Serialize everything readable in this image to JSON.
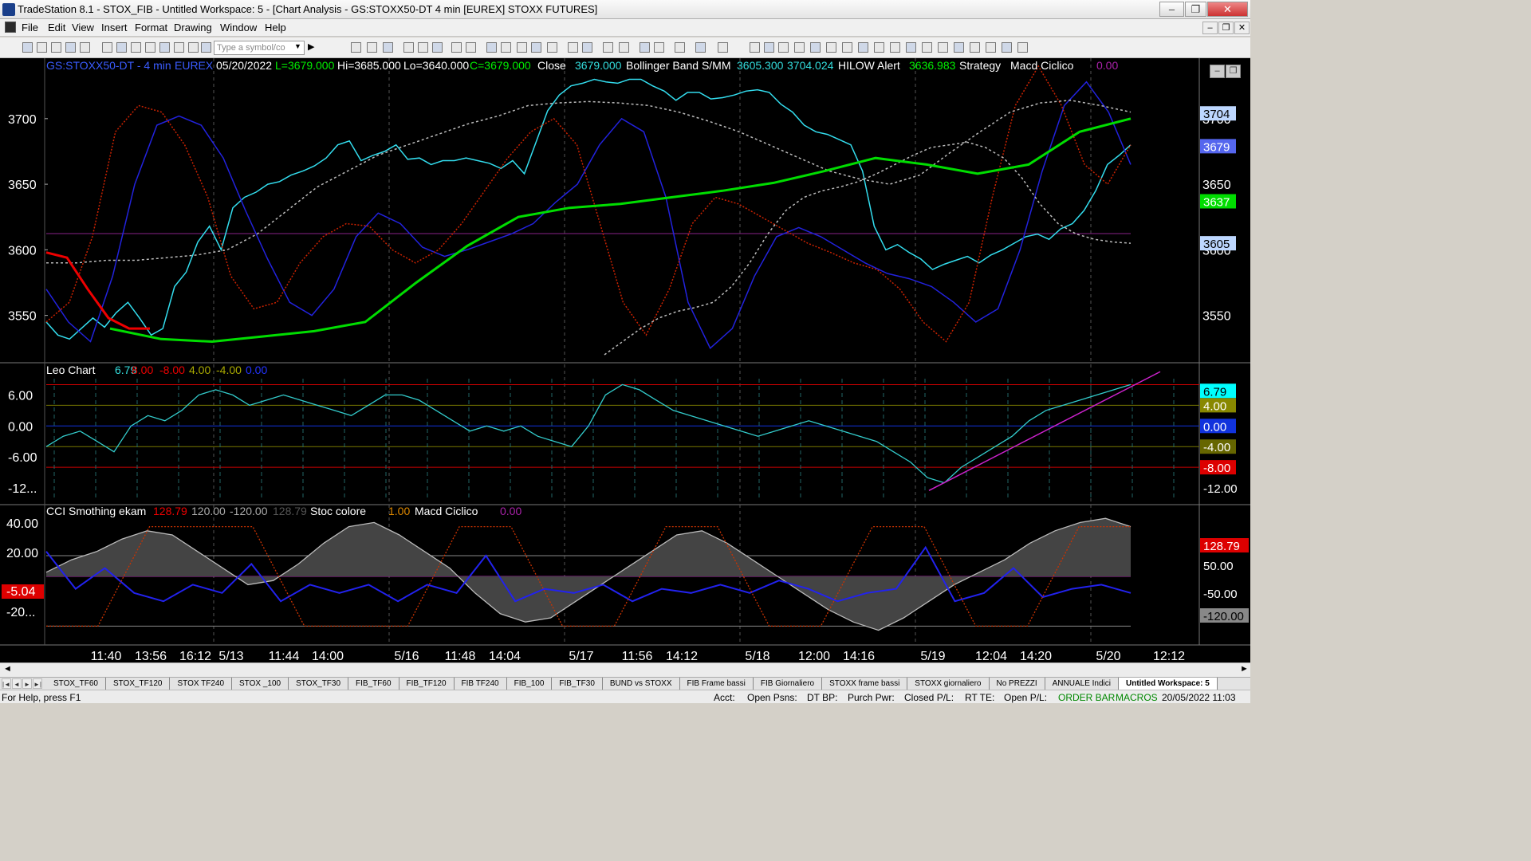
{
  "window": {
    "title": "TradeStation 8.1 - STOX_FIB - Untitled Workspace:  5 - [Chart Analysis - GS:STOXX50-DT  4 min  [EUREX] STOXX FUTURES]"
  },
  "menu": [
    "File",
    "Edit",
    "View",
    "Insert",
    "Format",
    "Drawing",
    "Window",
    "Help"
  ],
  "toolbar": {
    "symbol_placeholder": "Type a symbol/co"
  },
  "chart_data": [
    {
      "type": "line",
      "title": "GS:STOXX50-DT - 4 min",
      "exchange": "EUREX",
      "date": "05/20/2022",
      "header": {
        "symbol": "GS:STOXX50-DT - 4 min",
        "exchange": "EUREX",
        "date": "05/20/2022",
        "L": "L=3679.000",
        "Hi": "Hi=3685.000",
        "Lo": "Lo=3640.000",
        "C": "C=3679.000",
        "close_label": "Close",
        "close_value": "3679.000",
        "bb_label": "Bollinger Band S/MM",
        "bb1": "3605.300",
        "bb2": "3704.024",
        "hilow_label": "HILOW Alert",
        "hilow_value": "3636.983",
        "strategy_label": "Strategy",
        "macd_label": "Macd Ciclico",
        "macd_value": "0.00"
      },
      "ylim": [
        3520,
        3740
      ],
      "yticks": [
        "3700",
        "3650",
        "3600",
        "3550"
      ],
      "price_labels": [
        {
          "text": "3704",
          "color": "#bdd7ff",
          "text_color": "#000"
        },
        {
          "text": "3679",
          "color": "#5566ee",
          "text_color": "#ffffff"
        },
        {
          "text": "3637",
          "color": "#00dd00",
          "text_color": "#ffffff"
        },
        {
          "text": "3605",
          "color": "#bdd7ff",
          "text_color": "#000"
        }
      ],
      "xticks": [
        "11:40",
        "13:56",
        "16:12",
        "5/13",
        "11:44",
        "14:00",
        "5/16",
        "11:48",
        "14:04",
        "5/17",
        "11:56",
        "14:12",
        "5/18",
        "12:00",
        "14:16",
        "5/19",
        "12:04",
        "14:20",
        "5/20",
        "12:12"
      ],
      "series": [
        {
          "color": "#33ddee",
          "values": [
            3545,
            3535,
            3532,
            3540,
            3548,
            3541,
            3552,
            3560,
            3548,
            3535,
            3540,
            3572,
            3583,
            3606,
            3618,
            3600,
            3632,
            3640,
            3644,
            3650,
            3652,
            3657,
            3660,
            3664,
            3670,
            3680,
            3683,
            3668,
            3672,
            3675,
            3680,
            3669,
            3670,
            3665,
            3668,
            3668,
            3670,
            3668,
            3666,
            3662,
            3668,
            3658,
            3682,
            3706,
            3718,
            3725,
            3727,
            3730,
            3728,
            3727,
            3730,
            3730,
            3725,
            3721,
            3714,
            3720,
            3720,
            3715,
            3716,
            3718,
            3721,
            3722,
            3720,
            3711,
            3705,
            3695,
            3690,
            3688,
            3684,
            3680,
            3660,
            3618,
            3600,
            3604,
            3598,
            3593,
            3585,
            3589,
            3592,
            3595,
            3590,
            3596,
            3600,
            3605,
            3610,
            3612,
            3608,
            3616,
            3620,
            3630,
            3645,
            3665,
            3672,
            3680
          ]
        },
        {
          "color": "#2222dd",
          "values": [
            3570,
            3545,
            3530,
            3580,
            3650,
            3695,
            3702,
            3695,
            3670,
            3630,
            3593,
            3560,
            3550,
            3570,
            3610,
            3628,
            3620,
            3602,
            3595,
            3600,
            3606,
            3612,
            3620,
            3636,
            3650,
            3680,
            3700,
            3690,
            3640,
            3560,
            3525,
            3540,
            3580,
            3610,
            3617,
            3610,
            3600,
            3590,
            3582,
            3578,
            3572,
            3560,
            3545,
            3555,
            3600,
            3660,
            3710,
            3728,
            3705,
            3665
          ]
        },
        {
          "color": "#cc2200",
          "dash": "2 2",
          "values": [
            3545,
            3560,
            3610,
            3690,
            3710,
            3705,
            3680,
            3640,
            3580,
            3555,
            3560,
            3590,
            3610,
            3620,
            3618,
            3600,
            3590,
            3600,
            3620,
            3645,
            3670,
            3690,
            3700,
            3680,
            3620,
            3560,
            3535,
            3570,
            3620,
            3640,
            3635,
            3625,
            3615,
            3605,
            3598,
            3590,
            3585,
            3570,
            3545,
            3530,
            3560,
            3640,
            3710,
            3740,
            3710,
            3665,
            3650,
            3680
          ]
        },
        {
          "color": "#bbbbbb",
          "dash": "3 3",
          "values": [
            3590,
            3590,
            3592,
            3592,
            3594,
            3596,
            3600,
            3612,
            3630,
            3648,
            3660,
            3672,
            3680,
            3688,
            3696,
            3702,
            3710,
            3712,
            3713,
            3712,
            3710,
            3705,
            3698,
            3690,
            3680,
            3670,
            3660,
            3654,
            3650,
            3657,
            3674,
            3690,
            3705,
            3712,
            3714,
            3710,
            3705
          ]
        },
        {
          "color": "#bbbbbb",
          "dash": "3 3",
          "values": [
            3520,
            3530,
            3540,
            3548,
            3553,
            3556,
            3560,
            3572,
            3590,
            3612,
            3630,
            3640,
            3645,
            3648,
            3652,
            3658,
            3665,
            3672,
            3678,
            3680,
            3682,
            3678,
            3670,
            3655,
            3635,
            3620,
            3612,
            3608,
            3606,
            3605
          ]
        },
        {
          "color": "#00dd00",
          "values": [
            3540,
            3532,
            3530,
            3534,
            3538,
            3545,
            3575,
            3603,
            3625,
            3632,
            3635,
            3640,
            3645,
            3651,
            3660,
            3670,
            3665,
            3658,
            3665,
            3690,
            3700
          ]
        },
        {
          "color": "#ee0000",
          "values": [
            3598,
            3594,
            3570,
            3548,
            3540,
            3540
          ]
        }
      ]
    },
    {
      "title": "Leo Chart",
      "ylim": [
        -14,
        11
      ],
      "header": {
        "label": "Leo Chart",
        "v1": "6.79",
        "v2": "8.00",
        "v3": "-8.00",
        "v4": "4.00",
        "v5": "-4.00",
        "v6": "0.00"
      },
      "yticks": [
        "6.00",
        "0.00",
        "-6.00",
        "-12..."
      ],
      "price_labels": [
        {
          "text": "6.79",
          "color": "#00ffff",
          "text_color": "#000"
        },
        {
          "text": "4.00",
          "color": "#888800",
          "text_color": "#fff"
        },
        {
          "text": "0.00",
          "color": "#1133dd",
          "text_color": "#fff"
        },
        {
          "text": "-4.00",
          "color": "#666600",
          "text_color": "#fff"
        },
        {
          "text": "-8.00",
          "color": "#dd0000",
          "text_color": "#fff"
        },
        {
          "text": "-12.00",
          "color": "#000",
          "text_color": "#fff"
        }
      ],
      "series": [
        {
          "color": "#33cccc",
          "values": [
            -4,
            -2,
            -1,
            -3,
            -5,
            0,
            2,
            1,
            3,
            6,
            7,
            6,
            4,
            5,
            6,
            5,
            4,
            3,
            2,
            4,
            6,
            6,
            5,
            3,
            1,
            -1,
            0,
            -1,
            0,
            -2,
            -3,
            -4,
            0,
            6,
            8,
            7,
            5,
            3,
            2,
            1,
            0,
            -1,
            -2,
            -1,
            0,
            1,
            0,
            -1,
            -2,
            -3,
            -5,
            -7,
            -10,
            -11,
            -8,
            -6,
            -4,
            -2,
            1,
            3,
            4,
            5,
            6,
            7,
            8
          ]
        }
      ]
    },
    {
      "title": "CCI Smothing ekam",
      "header": {
        "cci_label": "CCI Smothing ekam",
        "cci_value": "128.79",
        "v120": "120.00",
        "vm120": "-120.00",
        "v3": "128.79",
        "stoc_label": "Stoc colore",
        "stoc_value": "1.00",
        "macd_label": "Macd Ciclico",
        "macd_value": "0.00"
      },
      "yticks": [
        "40.00",
        "20.00",
        "-5.04",
        "-20..."
      ],
      "price_labels_right": [
        {
          "text": "128.79",
          "color": "#dd0000",
          "text_color": "#fff"
        },
        {
          "text": "50.00",
          "color": "#000",
          "text_color": "#fff"
        },
        {
          "text": "-50.00",
          "color": "#000",
          "text_color": "#fff"
        },
        {
          "text": "-120.00",
          "color": "#888888",
          "text_color": "#000"
        }
      ],
      "left_label": {
        "text": "-5.04",
        "color": "#dd0000"
      },
      "series": [
        {
          "name": "",
          "color": "#bbbbbb",
          "values": [
            10,
            40,
            60,
            90,
            110,
            100,
            60,
            20,
            -20,
            -10,
            30,
            80,
            120,
            130,
            100,
            60,
            20,
            -40,
            -90,
            -110,
            -100,
            -60,
            -20,
            20,
            60,
            100,
            110,
            80,
            40,
            0,
            -40,
            -80,
            -110,
            -130,
            -100,
            -60,
            -20,
            10,
            40,
            80,
            110,
            130,
            140,
            120
          ]
        },
        {
          "name": "",
          "color": "#2222ee",
          "values": [
            60,
            -30,
            20,
            -40,
            -60,
            -20,
            -40,
            30,
            -60,
            -20,
            -40,
            -20,
            -60,
            -20,
            -40,
            50,
            -60,
            -30,
            -40,
            -20,
            -60,
            -30,
            -40,
            -20,
            -40,
            -10,
            -30,
            -60,
            -40,
            -30,
            70,
            -60,
            -40,
            20,
            -50,
            -30,
            -20,
            -40
          ]
        },
        {
          "name": "",
          "color": "#cc3300",
          "dash": "2 2",
          "values": [
            -120,
            -120,
            120,
            120,
            120,
            -120,
            -120,
            -120,
            120,
            120,
            -120,
            -120,
            120,
            120,
            -120,
            -120,
            120,
            120,
            -120,
            -120,
            120,
            120
          ]
        }
      ]
    }
  ],
  "scroll": {
    "left": "◄",
    "right": "►"
  },
  "tabs": [
    "STOX_TF60",
    "STOX_TF120",
    "STOX TF240",
    "STOX _100",
    "STOX_TF30",
    "FIB_TF60",
    "FIB_TF120",
    "FIB TF240",
    "FIB_100",
    "FIB_TF30",
    "BUND vs STOXX",
    "FIB Frame bassi",
    "FIB Giornaliero",
    "STOXX frame bassi",
    "STOXX giornaliero",
    "No PREZZI",
    "ANNUALE Indici",
    "Untitled Workspace:  5"
  ],
  "status": {
    "help": "For Help, press F1",
    "acct": "Acct:",
    "open_psns": "Open Psns:",
    "dt_bp": "DT BP:",
    "purch": "Purch Pwr:",
    "closed": "Closed P/L:",
    "rt": "RT TE:",
    "open_pl": "Open P/L:",
    "orderbar": "ORDER BAR",
    "macros": "MACROS",
    "datetime": "20/05/2022 11:03"
  }
}
